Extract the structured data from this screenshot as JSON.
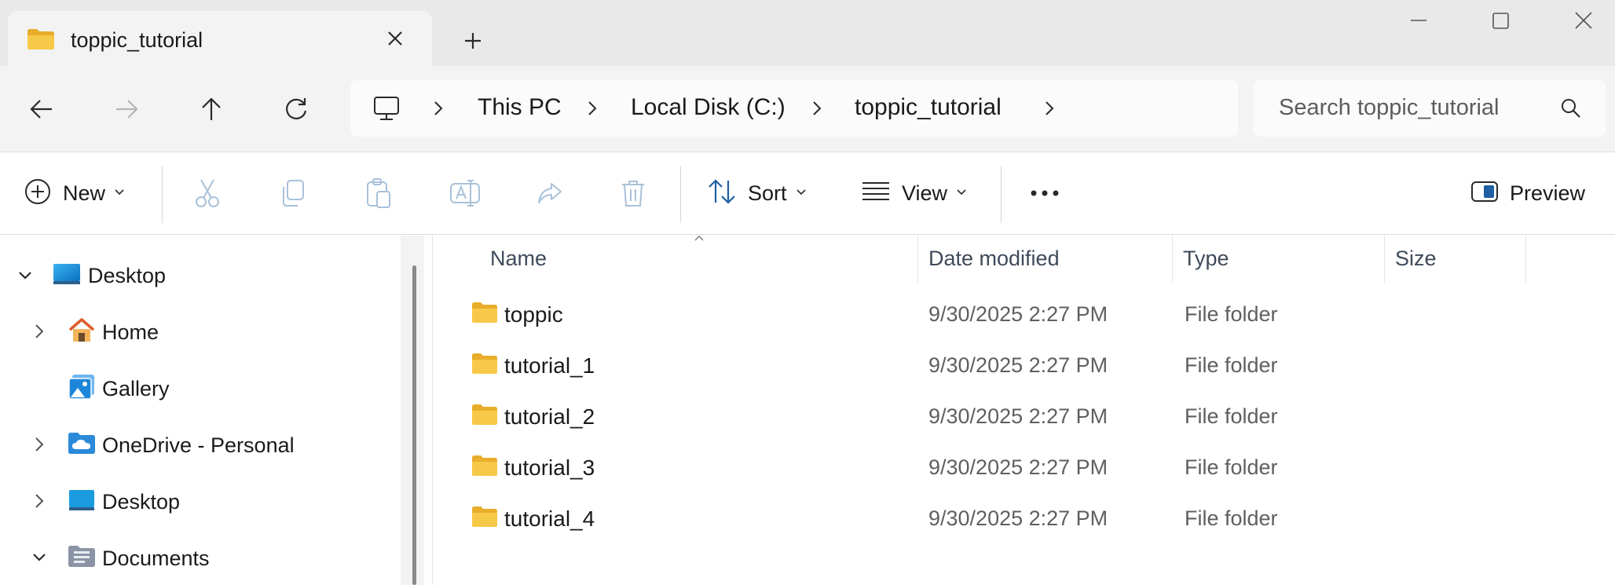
{
  "window": {
    "tab_title": "toppic_tutorial"
  },
  "address": {
    "crumbs": [
      "This PC",
      "Local Disk (C:)",
      "toppic_tutorial"
    ],
    "search_placeholder": "Search toppic_tutorial"
  },
  "toolbar": {
    "new_label": "New",
    "sort_label": "Sort",
    "view_label": "View",
    "preview_label": "Preview"
  },
  "nav": {
    "items": [
      {
        "label": "Desktop",
        "icon": "desktop-icon",
        "expanded": true
      },
      {
        "label": "Home",
        "icon": "home-icon",
        "expanded": false
      },
      {
        "label": "Gallery",
        "icon": "gallery-icon"
      },
      {
        "label": "OneDrive - Personal",
        "icon": "onedrive-icon",
        "expanded": false
      },
      {
        "label": "Desktop",
        "icon": "desktop-icon",
        "expanded": false
      },
      {
        "label": "Documents",
        "icon": "documents-icon",
        "expanded": true
      }
    ]
  },
  "files": {
    "columns": [
      "Name",
      "Date modified",
      "Type",
      "Size"
    ],
    "rows": [
      {
        "name": "toppic",
        "date": "9/30/2025 2:27 PM",
        "type": "File folder",
        "size": ""
      },
      {
        "name": "tutorial_1",
        "date": "9/30/2025 2:27 PM",
        "type": "File folder",
        "size": ""
      },
      {
        "name": "tutorial_2",
        "date": "9/30/2025 2:27 PM",
        "type": "File folder",
        "size": ""
      },
      {
        "name": "tutorial_3",
        "date": "9/30/2025 2:27 PM",
        "type": "File folder",
        "size": ""
      },
      {
        "name": "tutorial_4",
        "date": "9/30/2025 2:27 PM",
        "type": "File folder",
        "size": ""
      }
    ]
  },
  "colors": {
    "accent": "#0067c0",
    "folder": "#f7c948",
    "folder_dark": "#e8ad2a"
  }
}
